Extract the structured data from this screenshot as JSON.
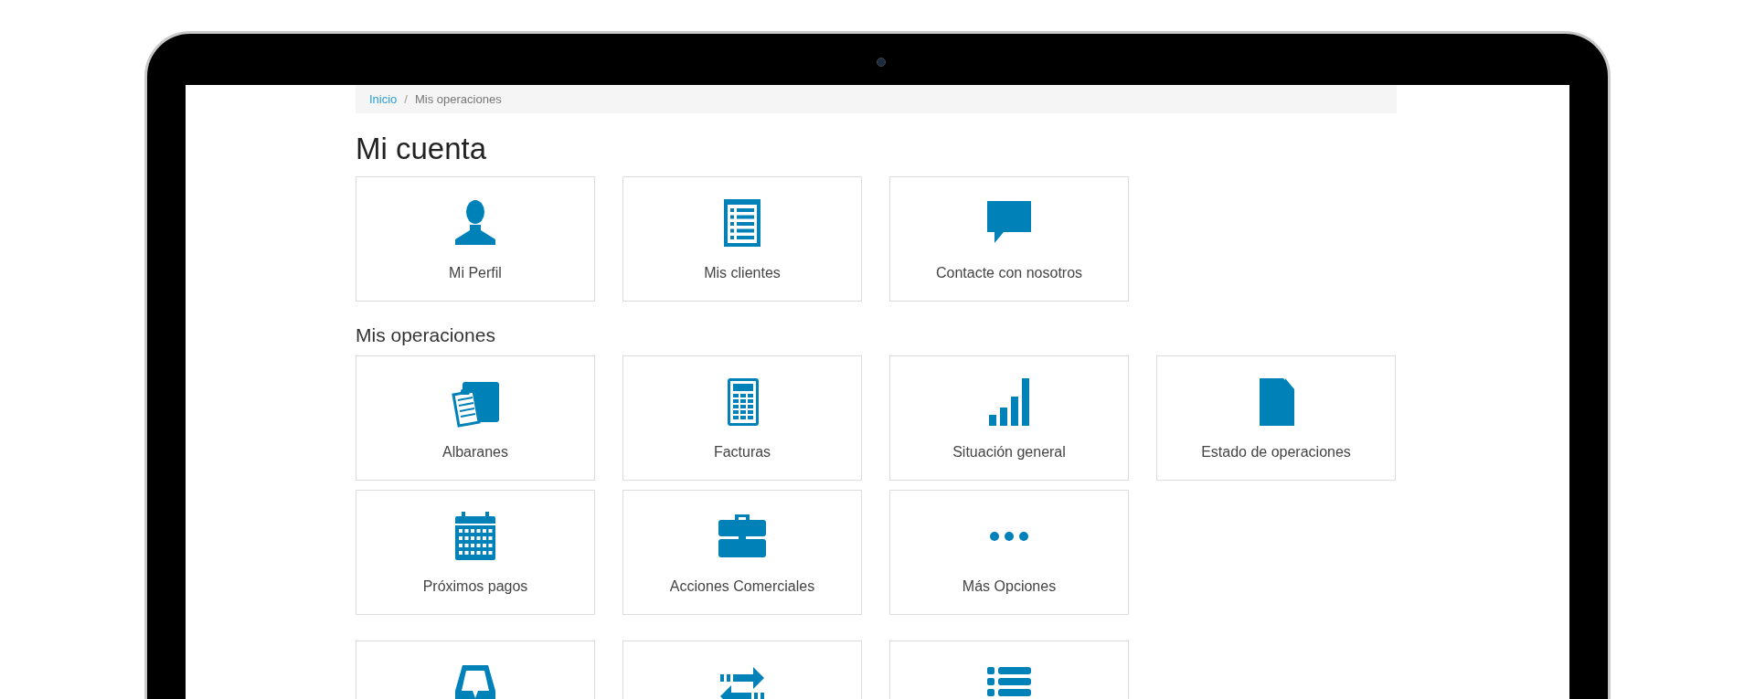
{
  "breadcrumb": {
    "items": [
      {
        "label": "Inicio",
        "link": true
      },
      {
        "label": "Mis operaciones",
        "link": false
      }
    ],
    "separator": "/"
  },
  "sections": [
    {
      "title": "Mi cuenta",
      "kind": "page-title",
      "rows": [
        [
          {
            "label": "Mi Perfil"
          },
          {
            "label": "Mis clientes"
          },
          {
            "label": "Contacte con nosotros"
          }
        ]
      ]
    },
    {
      "title": "Mis operaciones",
      "kind": "subtitle",
      "rows": [
        [
          {
            "label": "Albaranes"
          },
          {
            "label": "Facturas"
          },
          {
            "label": "Situación general"
          },
          {
            "label": "Estado de operaciones"
          }
        ],
        [
          {
            "label": "Próximos pagos"
          },
          {
            "label": "Acciones Comerciales"
          },
          {
            "label": "Más Opciones"
          }
        ],
        [
          {},
          {},
          {}
        ]
      ]
    }
  ]
}
